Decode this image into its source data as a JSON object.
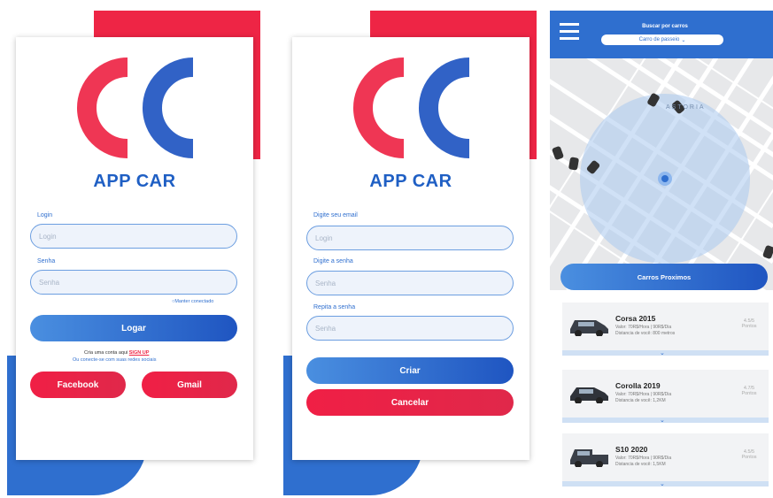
{
  "screen1": {
    "title": "APP CAR",
    "login_label": "Login",
    "login_placeholder": "Login",
    "password_label": "Senha",
    "password_placeholder": "Senha",
    "keep_connected": "Manter conectado",
    "login_button": "Logar",
    "create_account_text": "Cria uma conta aqui",
    "signup_link": "SIGN UP",
    "social_text": "Ou conecte-se com suas redes sociais",
    "facebook_button": "Facebook",
    "gmail_button": "Gmail"
  },
  "screen2": {
    "title": "APP CAR",
    "email_label": "Digite seu email",
    "email_placeholder": "Login",
    "password_label": "Digite a senha",
    "password_placeholder": "Senha",
    "repeat_label": "Repita a senha",
    "repeat_placeholder": "Senha",
    "create_button": "Criar",
    "cancel_button": "Cancelar"
  },
  "screen3": {
    "header_title": "Buscar por carros",
    "filter_value": "Carro de passeio",
    "map_area_label": "ASTORIA",
    "nearby_button": "Carros Proximos",
    "cars": [
      {
        "name": "Corsa 2015",
        "line1": "Valor: 70R$/Hora | 90R$/Dia",
        "line2": "Distancia de você: 800 metros",
        "rating": "4.5/5",
        "rating_label": "Pontos"
      },
      {
        "name": "Corolla 2019",
        "line1": "Valor: 70R$/Hora | 90R$/Dia",
        "line2": "Distancia de você: 1,2KM",
        "rating": "4.7/5",
        "rating_label": "Pontos"
      },
      {
        "name": "S10 2020",
        "line1": "Valor: 70R$/Hora | 90R$/Dia",
        "line2": "Distancia de você: 1,5KM",
        "rating": "4.5/5",
        "rating_label": "Pontos"
      }
    ]
  },
  "colors": {
    "brand_red": "#ee2545",
    "brand_blue": "#2f6fcf"
  }
}
